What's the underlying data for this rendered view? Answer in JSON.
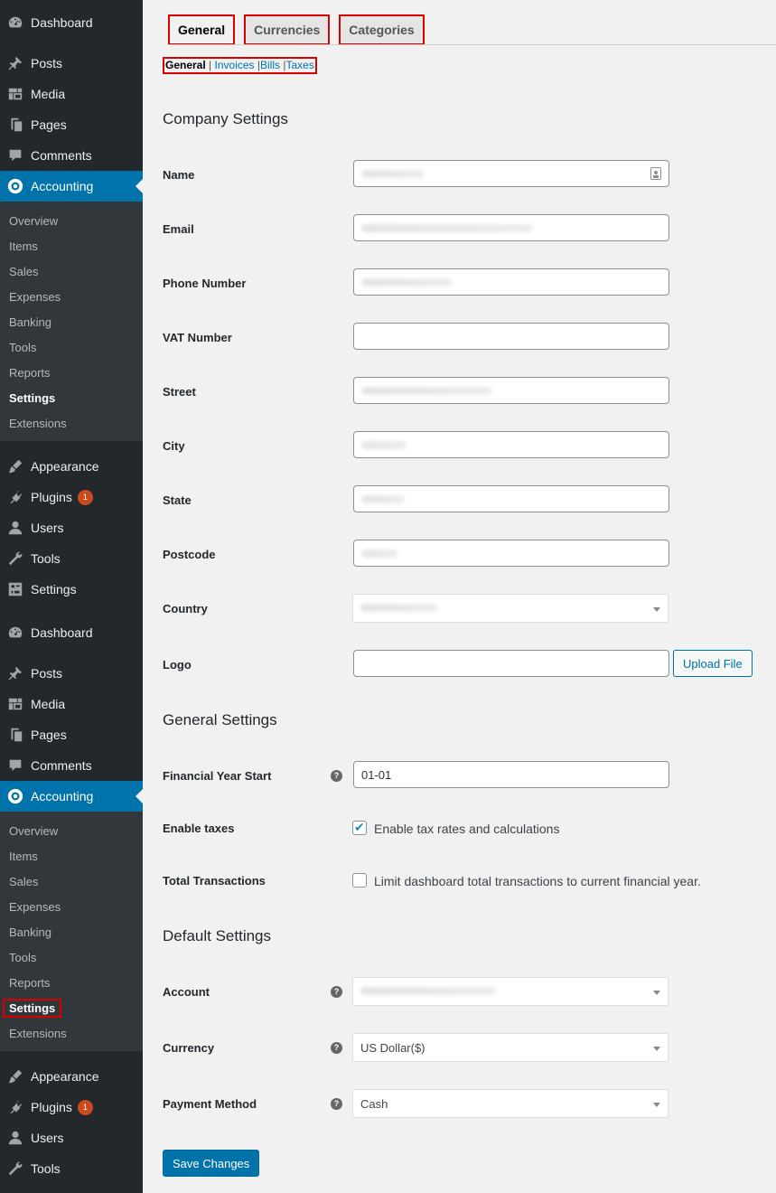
{
  "sidebar": {
    "group1": {
      "top_items": [
        {
          "label": "Dashboard",
          "icon": "dashboard-icon"
        }
      ],
      "content_items": [
        {
          "label": "Posts",
          "icon": "pin-icon"
        },
        {
          "label": "Media",
          "icon": "media-icon"
        },
        {
          "label": "Pages",
          "icon": "pages-icon"
        },
        {
          "label": "Comments",
          "icon": "comments-icon"
        }
      ],
      "active": {
        "label": "Accounting",
        "icon": "accounting-icon"
      },
      "submenu": [
        "Overview",
        "Items",
        "Sales",
        "Expenses",
        "Banking",
        "Tools",
        "Reports",
        "Settings",
        "Extensions"
      ],
      "bottom_items": [
        {
          "label": "Appearance",
          "icon": "appearance-icon"
        },
        {
          "label": "Plugins",
          "icon": "plugins-icon",
          "badge": "1"
        },
        {
          "label": "Users",
          "icon": "users-icon"
        },
        {
          "label": "Tools",
          "icon": "tools-icon"
        },
        {
          "label": "Settings",
          "icon": "settings-icon"
        }
      ]
    },
    "group2": {
      "top_items": [
        {
          "label": "Dashboard",
          "icon": "dashboard-icon"
        }
      ],
      "content_items": [
        {
          "label": "Posts",
          "icon": "pin-icon"
        },
        {
          "label": "Media",
          "icon": "media-icon"
        },
        {
          "label": "Pages",
          "icon": "pages-icon"
        },
        {
          "label": "Comments",
          "icon": "comments-icon"
        }
      ],
      "active": {
        "label": "Accounting",
        "icon": "accounting-icon"
      },
      "submenu": [
        "Overview",
        "Items",
        "Sales",
        "Expenses",
        "Banking",
        "Tools",
        "Reports",
        "Settings",
        "Extensions"
      ],
      "bottom_items": [
        {
          "label": "Appearance",
          "icon": "appearance-icon"
        },
        {
          "label": "Plugins",
          "icon": "plugins-icon",
          "badge": "1"
        },
        {
          "label": "Users",
          "icon": "users-icon"
        },
        {
          "label": "Tools",
          "icon": "tools-icon"
        }
      ]
    },
    "current_submenu": "Settings"
  },
  "tabs": [
    "General",
    "Currencies",
    "Categories"
  ],
  "subsubsub": {
    "current": "General",
    "links": [
      "Invoices",
      "Bills",
      "Taxes"
    ],
    "separator": "|"
  },
  "company": {
    "title": "Company Settings",
    "fields": [
      "Name",
      "Email",
      "Phone Number",
      "VAT Number",
      "Street",
      "City",
      "State",
      "Postcode",
      "Country",
      "Logo"
    ],
    "upload_label": "Upload File"
  },
  "general": {
    "title": "General Settings",
    "financial_year_label": "Financial Year Start",
    "financial_year_value": "01-01",
    "enable_taxes_label": "Enable taxes",
    "enable_taxes_text": "Enable tax rates and calculations",
    "enable_taxes_checked": true,
    "total_transactions_label": "Total Transactions",
    "total_transactions_text": "Limit dashboard total transactions to current financial year.",
    "total_transactions_checked": false
  },
  "defaults": {
    "title": "Default Settings",
    "account_label": "Account",
    "currency_label": "Currency",
    "currency_value": "US Dollar($)",
    "payment_label": "Payment Method",
    "payment_value": "Cash"
  },
  "save_label": "Save Changes",
  "help_glyph": "?",
  "colors": {
    "sidebar": "#23282d",
    "active": "#0073aa",
    "highlight": "#d90000",
    "badge": "#ca4a1f"
  }
}
